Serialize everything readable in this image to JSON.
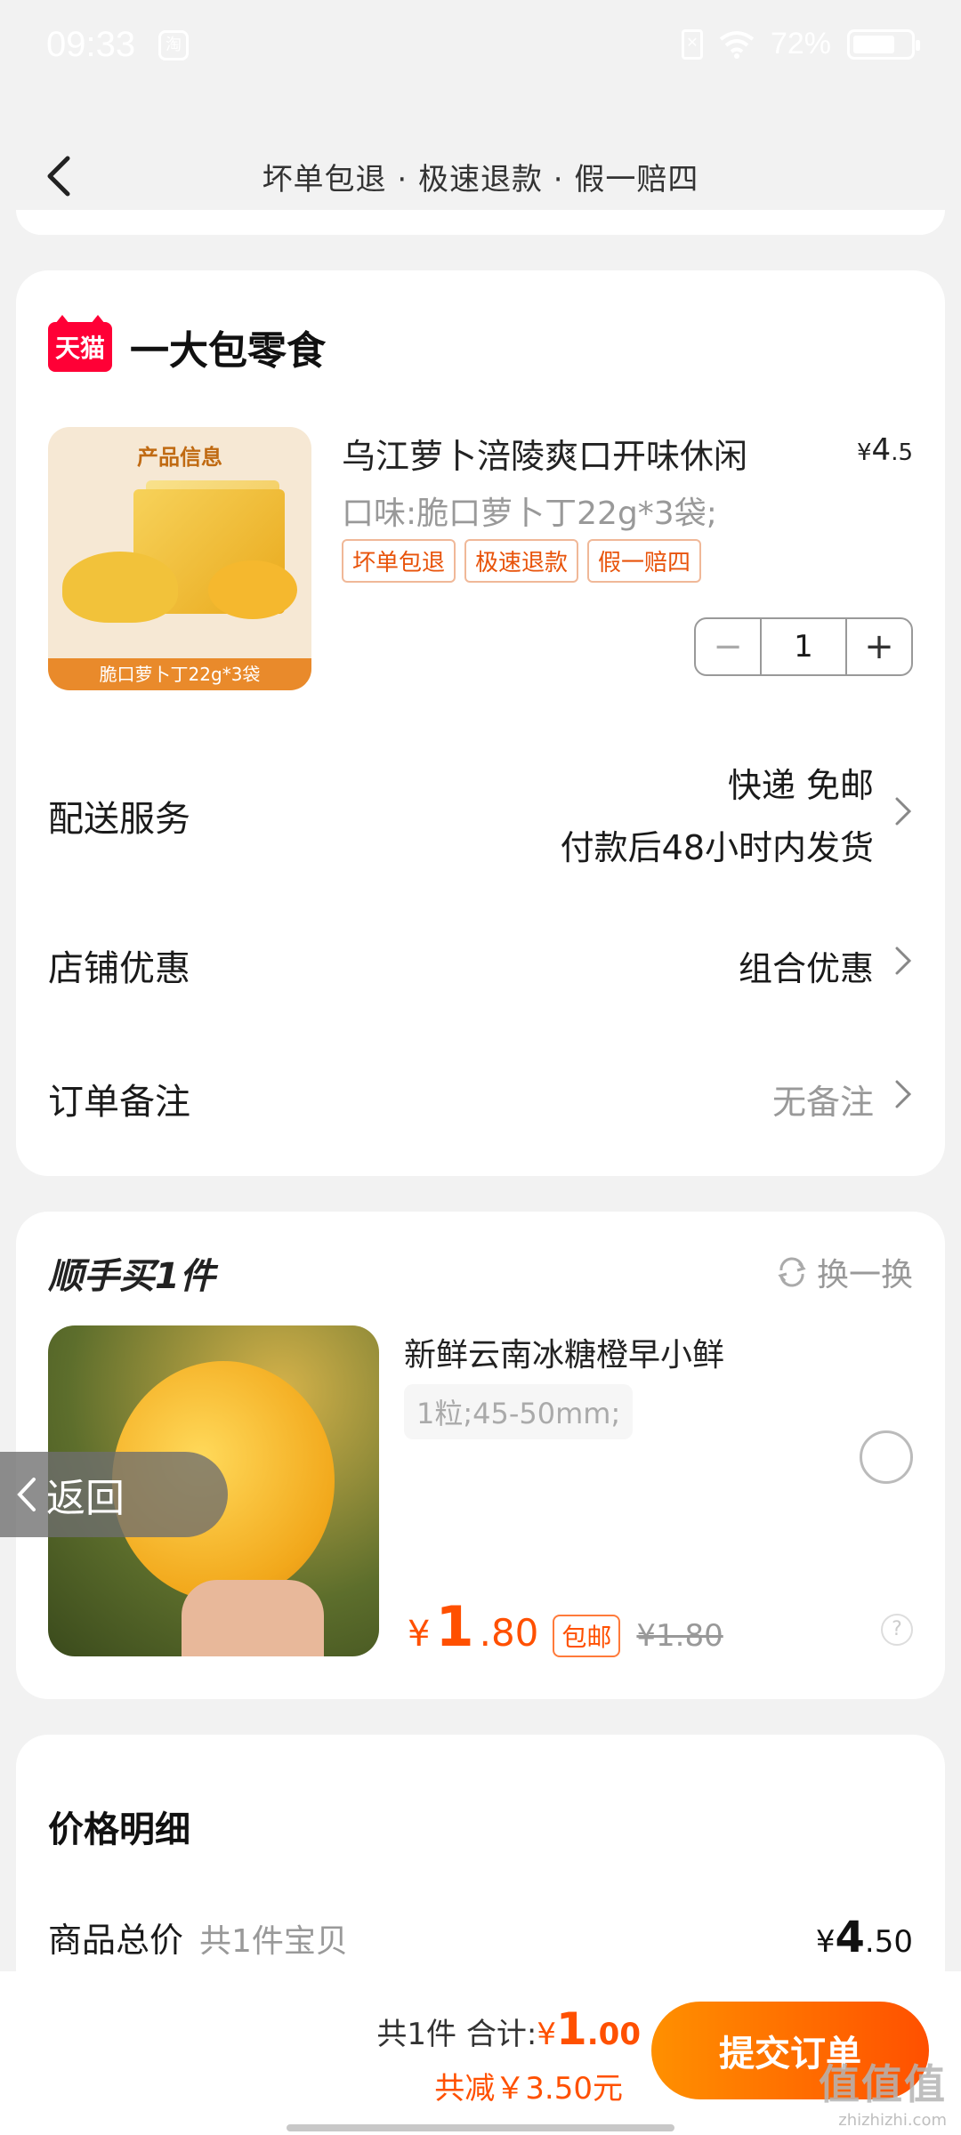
{
  "status_bar": {
    "time": "09:33",
    "app_icon": "淘",
    "sim": "✕",
    "battery": "72%",
    "battery_level": 0.72
  },
  "nav": {
    "title": "坏单包退 · 极速退款 · 假一赔四"
  },
  "shop": {
    "logo_text": "天猫",
    "name": "一大包零食",
    "product": {
      "image_label": "产品信息",
      "image_caption": "脆口萝卜丁22g*3袋",
      "title": "乌江萝卜涪陵爽口开味休闲",
      "price_symbol": "¥",
      "price_int": "4",
      "price_dec": ".5",
      "spec": "口味:脆口萝卜丁22g*3袋;",
      "tags": [
        "坏单包退",
        "极速退款",
        "假一赔四"
      ],
      "quantity": "1",
      "minus": "−",
      "plus": "+"
    },
    "delivery": {
      "label": "配送服务",
      "line1": "快递 免邮",
      "line2": "付款后48小时内发货"
    },
    "shop_discount": {
      "label": "店铺优惠",
      "value": "组合优惠"
    },
    "remark": {
      "label": "订单备注",
      "value": "无备注"
    }
  },
  "recommend": {
    "title": "顺手买1件",
    "swap_label": "换一换",
    "name": "新鲜云南冰糖橙早小鲜",
    "spec": "1粒;45-50mm;",
    "price_symbol": "¥",
    "price_int": "1",
    "price_dec": ".80",
    "badge": "包邮",
    "original_price": "¥1.80",
    "help": "?"
  },
  "floating_back": {
    "label": "返回"
  },
  "price_detail": {
    "title": "价格明细",
    "goods_total_label": "商品总价",
    "goods_count": "共1件宝贝",
    "goods_total_symbol": "¥",
    "goods_total_int": "4",
    "goods_total_dec": ".50"
  },
  "bottom_bar": {
    "count": "共1件",
    "total_label": "合计:",
    "total_symbol": "¥",
    "total_int": "1",
    "total_dec": ".00",
    "discount": "共减￥3.50元",
    "submit": "提交订单"
  },
  "watermark": {
    "cn": "值值值",
    "en": "zhizhizhi.com"
  },
  "colors": {
    "accent": "#ff5000",
    "tmall_red": "#ff0036",
    "background": "#f2f2f2"
  }
}
